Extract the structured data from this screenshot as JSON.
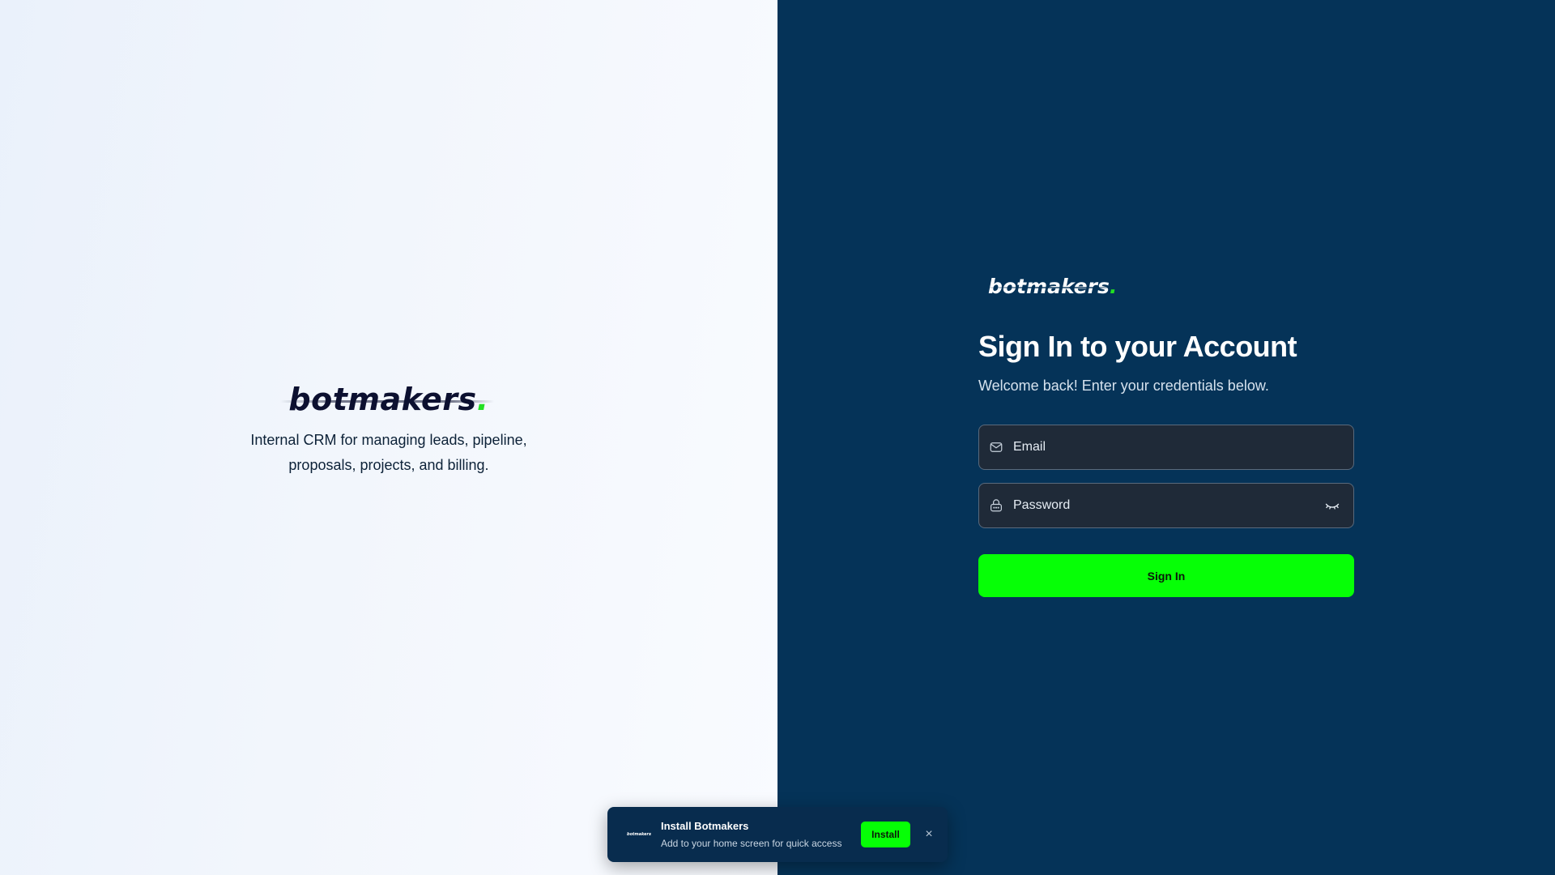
{
  "brand": {
    "logo_text": "botmakers",
    "logo_dot": ".",
    "tagline": "Internal CRM for managing leads, pipeline, proposals, projects, and billing."
  },
  "signin": {
    "title": "Sign In to your Account",
    "subtitle": "Welcome back! Enter your credentials below.",
    "email_placeholder": "Email",
    "password_placeholder": "Password",
    "submit_label": "Sign In"
  },
  "install_toast": {
    "logo_text": "botmakers",
    "title": "Install Botmakers",
    "description": "Add to your home screen for quick access",
    "install_label": "Install",
    "close_icon": "×"
  },
  "icons": {
    "email": "mail-icon",
    "password": "lock-icon",
    "toggle_visibility": "eye-closed-icon",
    "close": "close-icon"
  },
  "colors": {
    "left_bg": "#eef3fb",
    "right_bg": "#053358",
    "accent": "#06ff06",
    "input_bg": "#1f2a38",
    "toast_bg": "#082c4e"
  }
}
